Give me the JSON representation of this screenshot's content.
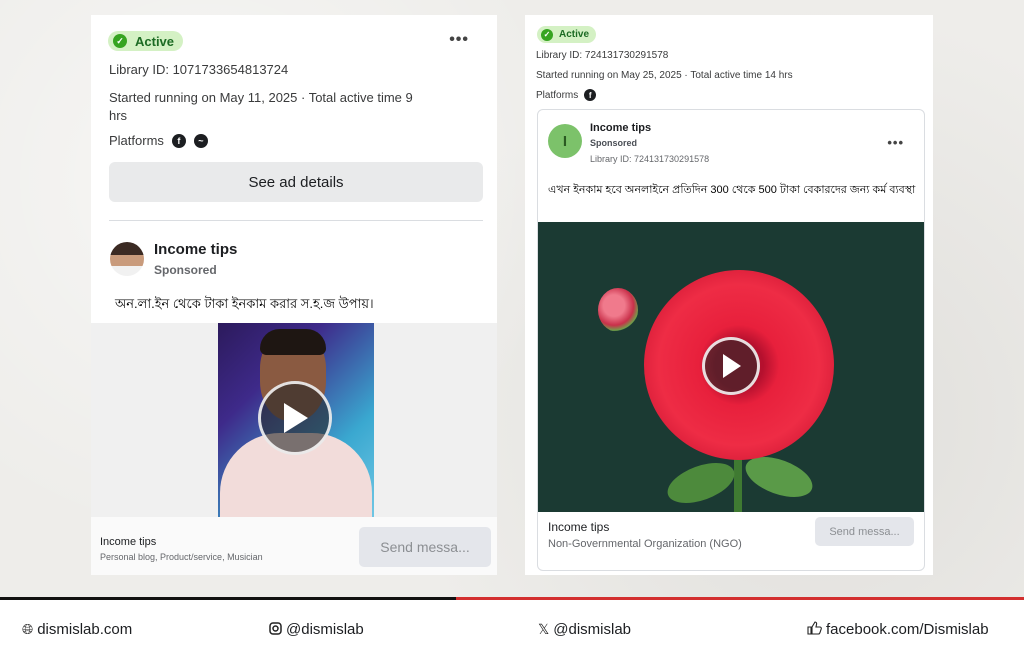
{
  "left_card": {
    "status": "Active",
    "menu_dots": "•••",
    "library_id": "Library ID: 1071733654813724",
    "started": "Started running on May 11, 2025 · Total active time 9 hrs",
    "platforms_label": "Platforms",
    "platform_icons": [
      "facebook-icon",
      "messenger-icon"
    ],
    "see_details": "See ad details",
    "page_name": "Income tips",
    "sponsored": "Sponsored",
    "ad_text": "অন.লা.ইন থেকে টাকা ইনকাম করার স.হ.জ উপায়।",
    "footer_name": "Income tips",
    "footer_sub": "Personal blog, Product/service, Musician",
    "send_button": "Send messa..."
  },
  "right_card": {
    "status": "Active",
    "library_id": "Library ID: 724131730291578",
    "started": "Started running on May 25, 2025 · Total active time 14 hrs",
    "platforms_label": "Platforms",
    "platform_icons": [
      "facebook-icon"
    ],
    "avatar_letter": "I",
    "page_name": "Income tips",
    "sponsored": "Sponsored",
    "library_id_inner": "Library ID: 724131730291578",
    "menu_dots": "•••",
    "ad_text": "এখন ইনকাম হবে অনলাইনে প্রতিদিন 300 থেকে 500 টাকা বেকারদের জন্য কর্ম ব্যবস্থা",
    "footer_name": "Income tips",
    "footer_sub": "Non-Governmental Organization (NGO)",
    "send_button": "Send messa..."
  },
  "footer": {
    "website": "dismislab.com",
    "instagram": "@dismislab",
    "x": "@dismislab",
    "facebook": "facebook.com/Dismislab",
    "icons": [
      "globe-icon",
      "instagram-icon",
      "x-icon",
      "thumbs-up-icon"
    ]
  },
  "colors": {
    "active_badge_bg": "#d4f1c4",
    "active_check": "#36a420",
    "footer_accent_red": "#d32f2f"
  }
}
